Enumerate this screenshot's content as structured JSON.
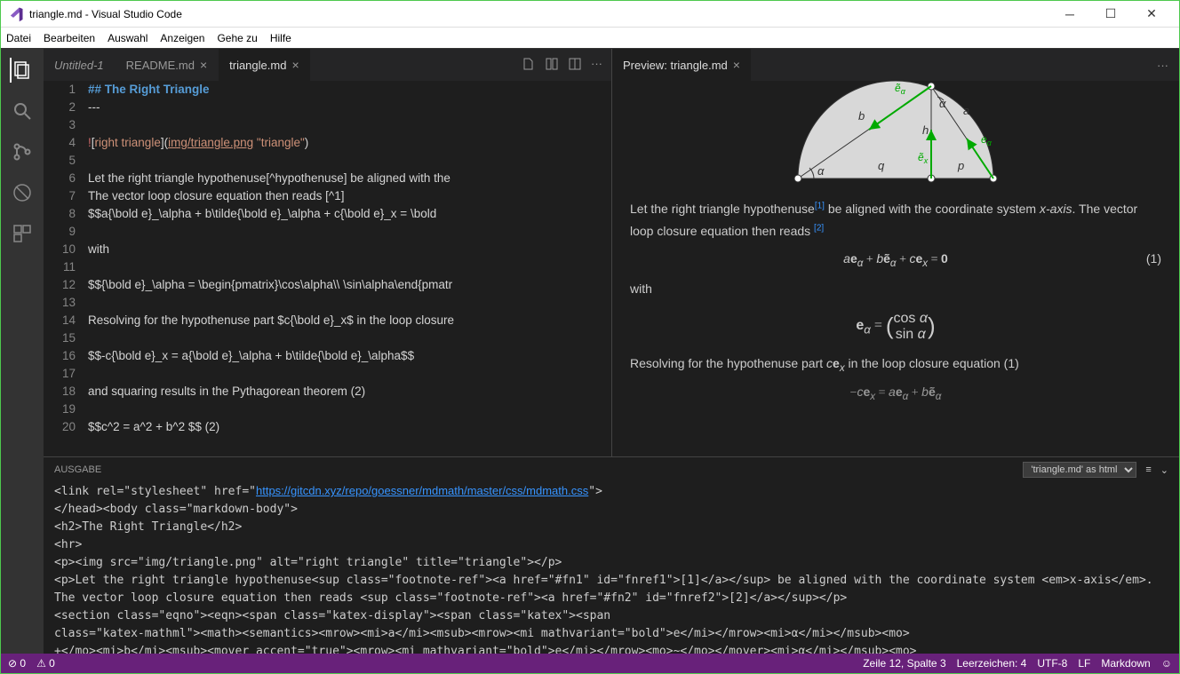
{
  "window": {
    "title": "triangle.md - Visual Studio Code"
  },
  "menu": [
    "Datei",
    "Bearbeiten",
    "Auswahl",
    "Anzeigen",
    "Gehe zu",
    "Hilfe"
  ],
  "tabs": {
    "items": [
      {
        "label": "Untitled-1",
        "italic": true,
        "active": false,
        "closable": false
      },
      {
        "label": "README.md",
        "italic": false,
        "active": false,
        "closable": true
      },
      {
        "label": "triangle.md",
        "italic": false,
        "active": true,
        "closable": true
      }
    ]
  },
  "preview_tab": {
    "label": "Preview: triangle.md"
  },
  "editor": {
    "lines": [
      {
        "n": 1,
        "html": "<span class='c-blue'>## The Right Triangle</span>"
      },
      {
        "n": 2,
        "html": "---"
      },
      {
        "n": 3,
        "html": ""
      },
      {
        "n": 4,
        "html": "<span class='c-red'>!</span>[<span class='c-orange'>right triangle</span>](<span class='c-link'>img/triangle.png</span> <span class='c-orange'>\"triangle\"</span>)"
      },
      {
        "n": 5,
        "html": ""
      },
      {
        "n": 6,
        "html": "Let the right triangle hypothenuse[^hypothenuse] be aligned with the"
      },
      {
        "n": 7,
        "html": "The vector loop closure equation then reads [^1]"
      },
      {
        "n": 8,
        "html": "$$a{\\bold e}_\\alpha + b\\tilde{\\bold e}_\\alpha + c{\\bold e}_x = \\bold"
      },
      {
        "n": 9,
        "html": ""
      },
      {
        "n": 10,
        "html": "with"
      },
      {
        "n": 11,
        "html": ""
      },
      {
        "n": 12,
        "html": "$${\\bold e}_\\alpha = \\begin{pmatrix}\\cos\\alpha\\\\ \\sin\\alpha\\end{pmatr"
      },
      {
        "n": 13,
        "html": ""
      },
      {
        "n": 14,
        "html": "Resolving for the hypothenuse part $c{\\bold e}_x$ in the loop closure"
      },
      {
        "n": 15,
        "html": ""
      },
      {
        "n": 16,
        "html": "$$-c{\\bold e}_x = a{\\bold e}_\\alpha + b\\tilde{\\bold e}_\\alpha$$"
      },
      {
        "n": 17,
        "html": ""
      },
      {
        "n": 18,
        "html": "and squaring results in the Pythagorean theorem (2)"
      },
      {
        "n": 19,
        "html": ""
      },
      {
        "n": 20,
        "html": "$$c^2 = a^2 + b^2 $$ (2)"
      }
    ]
  },
  "preview": {
    "p1_a": "Let the right triangle hypothenuse",
    "p1_b": " be aligned with the coordinate system ",
    "p1_c": ". The vector loop closure equation then reads ",
    "xaxis": "x-axis",
    "ref1": "[1]",
    "ref2": "[2]",
    "eq1": "a𝐞α + b𝐞̃α + c𝐞x = 𝟎",
    "eq1num": "(1)",
    "with": "with",
    "eq2": "𝐞α = ( cos α  sin α )",
    "p2_a": "Resolving for the hypothenuse part ",
    "p2_b": "c𝐞x",
    "p2_c": " in the loop closure equation (1)",
    "eq3": "−c𝐞x = a𝐞α + b𝐞̃α"
  },
  "panel": {
    "title": "AUSGABE",
    "dropdown": "'triangle.md' as html",
    "lines": [
      "&lt;link rel=\"stylesheet\" href=\"<a>https://gitcdn.xyz/repo/goessner/mdmath/master/css/mdmath.css</a>\"&gt;",
      "&lt;/head&gt;&lt;body class=\"markdown-body\"&gt;",
      "&lt;h2&gt;The Right Triangle&lt;/h2&gt;",
      "&lt;hr&gt;",
      "&lt;p&gt;&lt;img src=\"img/triangle.png\" alt=\"right triangle\" title=\"triangle\"&gt;&lt;/p&gt;",
      "&lt;p&gt;Let the right triangle hypothenuse&lt;sup class=\"footnote-ref\"&gt;&lt;a href=\"#fn1\" id=\"fnref1\"&gt;[1]&lt;/a&gt;&lt;/sup&gt; be aligned with the coordinate system &lt;em&gt;x-axis&lt;/em&gt;.",
      "The vector loop closure equation then reads &lt;sup class=\"footnote-ref\"&gt;&lt;a href=\"#fn2\" id=\"fnref2\"&gt;[2]&lt;/a&gt;&lt;/sup&gt;&lt;/p&gt;",
      "&lt;section class=\"eqno\"&gt;&lt;eqn&gt;&lt;span class=\"katex-display\"&gt;&lt;span class=\"katex\"&gt;&lt;span",
      "class=\"katex-mathml\"&gt;&lt;math&gt;&lt;semantics&gt;&lt;mrow&gt;&lt;mi&gt;a&lt;/mi&gt;&lt;msub&gt;&lt;mrow&gt;&lt;mi mathvariant=\"bold\"&gt;e&lt;/mi&gt;&lt;/mrow&gt;&lt;mi&gt;α&lt;/mi&gt;&lt;/msub&gt;&lt;mo&gt;",
      "+&lt;/mo&gt;&lt;mi&gt;b&lt;/mi&gt;&lt;msub&gt;&lt;mover accent=\"true\"&gt;&lt;mrow&gt;&lt;mi mathvariant=\"bold\"&gt;e&lt;/mi&gt;&lt;/mrow&gt;&lt;mo&gt;~&lt;/mo&gt;&lt;/mover&gt;&lt;mi&gt;α&lt;/mi&gt;&lt;/msub&gt;&lt;mo&gt;"
    ]
  },
  "statusbar": {
    "errors": "0",
    "warnings": "0",
    "cursor": "Zeile 12, Spalte 3",
    "spaces": "Leerzeichen: 4",
    "encoding": "UTF-8",
    "eol": "LF",
    "lang": "Markdown"
  },
  "chart_data": {
    "type": "diagram",
    "description": "Right triangle inscribed in a semicircle",
    "labels": [
      "a",
      "b",
      "h",
      "p",
      "q",
      "α",
      "ẽα",
      "ẽx",
      "eα"
    ],
    "vectors": [
      {
        "name": "eα",
        "color": "green"
      },
      {
        "name": "ẽα",
        "color": "green"
      },
      {
        "name": "ẽx",
        "color": "green"
      }
    ]
  }
}
